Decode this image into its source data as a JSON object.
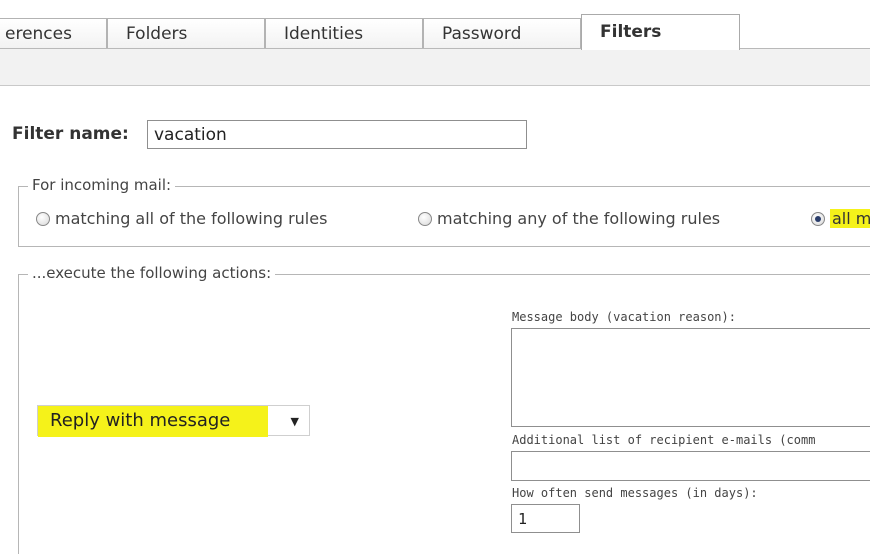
{
  "tabs": [
    {
      "label": "erences"
    },
    {
      "label": "Folders"
    },
    {
      "label": "Identities"
    },
    {
      "label": "Password"
    },
    {
      "label": "Filters",
      "active": true
    }
  ],
  "filter_name": {
    "label": "Filter name:",
    "value": "vacation"
  },
  "incoming": {
    "legend": "For incoming mail:",
    "options": [
      {
        "label": "matching all of the following rules",
        "checked": false
      },
      {
        "label": "matching any of the following rules",
        "checked": false
      },
      {
        "label": "all m",
        "checked": true
      }
    ]
  },
  "actions": {
    "legend": "...execute the following actions:",
    "selected_action": "Reply with message",
    "body_label": "Message body (vacation reason):",
    "recipients_label": "Additional list of recipient e-mails (comm",
    "days_label": "How often send messages (in days):",
    "days_value": "1"
  },
  "colors": {
    "highlight": "#f5f21a"
  }
}
